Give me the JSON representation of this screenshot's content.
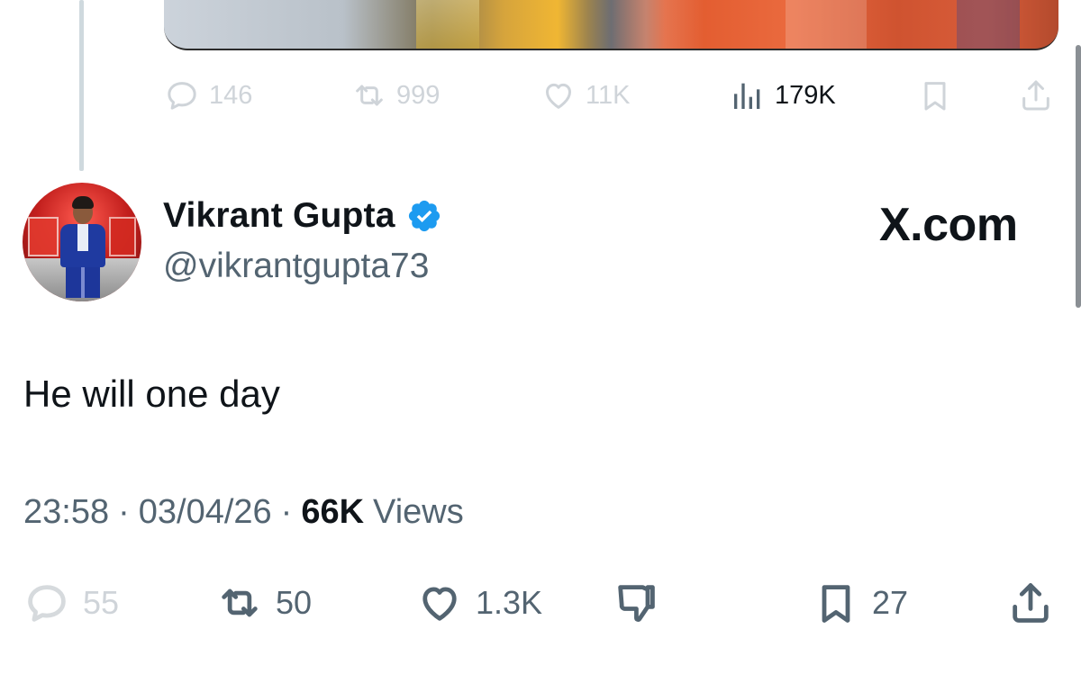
{
  "parent_tweet": {
    "actions": {
      "replies": "146",
      "reposts": "999",
      "likes": "11K",
      "views": "179K"
    }
  },
  "main_tweet": {
    "author": {
      "display_name": "Vikrant Gupta",
      "handle": "@vikrantgupta73",
      "verified": true
    },
    "brand": "X.com",
    "text": "He will one day",
    "time": "23:58",
    "date": "03/04/26",
    "views_count": "66K",
    "views_label": "Views",
    "separator": "·",
    "actions": {
      "replies": "55",
      "reposts": "50",
      "likes": "1.3K",
      "bookmarks": "27"
    }
  },
  "colors": {
    "text_primary": "#0f1419",
    "text_secondary": "#536471",
    "muted_icon": "#cfd4d9",
    "verified_blue": "#1d9bf0"
  },
  "icons": {
    "reply": "speech-bubble-icon",
    "repost": "repost-arrows-icon",
    "like": "heart-icon",
    "views": "bar-chart-icon",
    "bookmark": "bookmark-icon",
    "share": "share-upload-icon",
    "dislike": "thumbs-down-icon",
    "verified": "verified-badge-icon"
  }
}
